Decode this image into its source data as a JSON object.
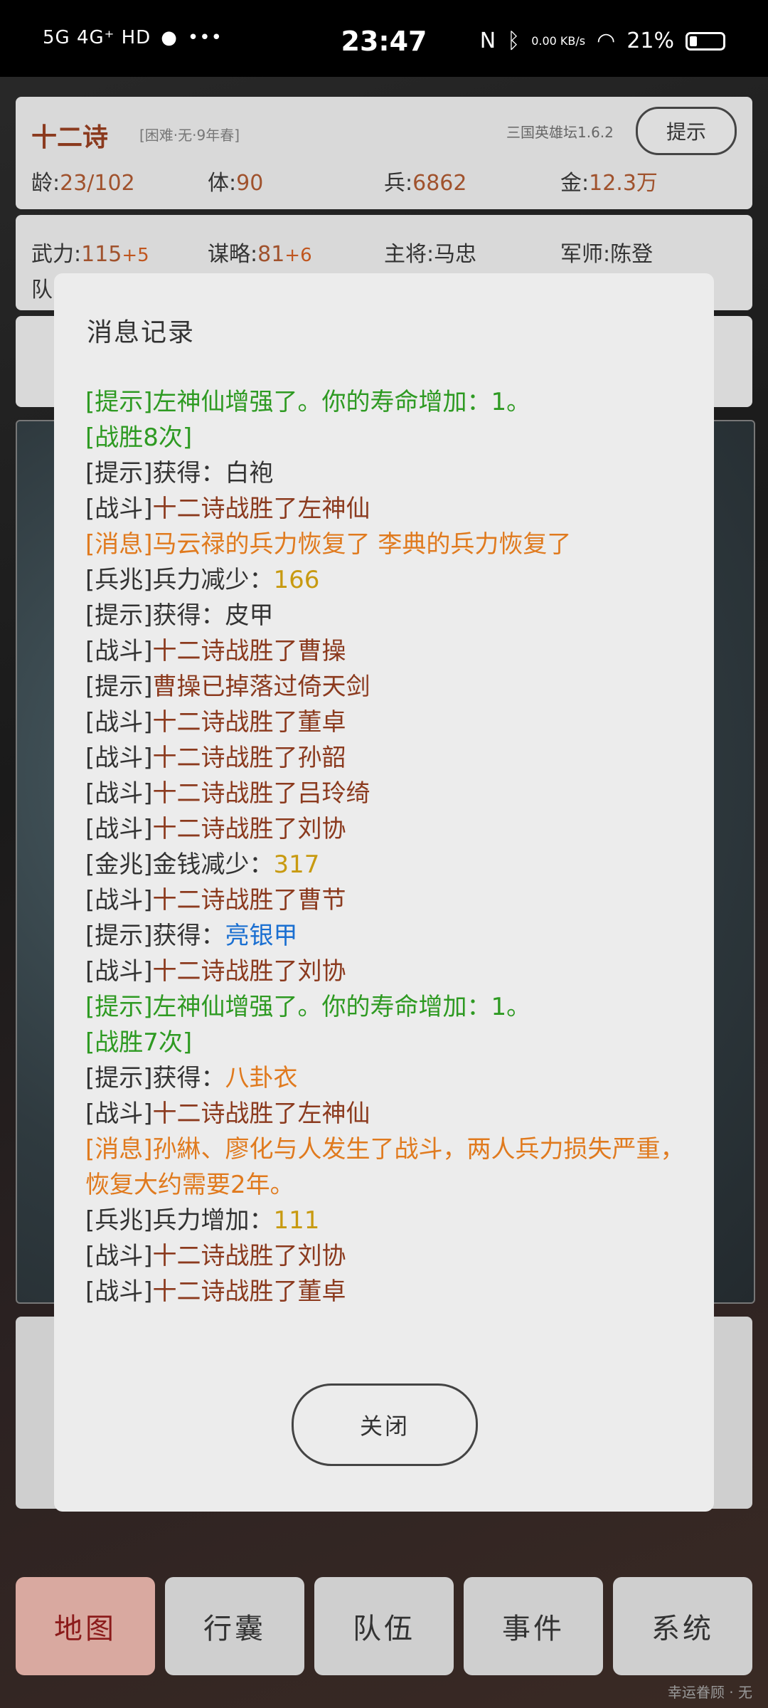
{
  "statusbar": {
    "network": "5G 4G⁺ HD",
    "time": "23:47",
    "speed": "0.00 KB/s",
    "battery": "21%"
  },
  "hero": {
    "name": "十二诗",
    "sub": "[困难·无·9年春]",
    "version": "三国英雄坛1.6.2",
    "hint_label": "提示",
    "age_label": "龄:",
    "age_value": "23/102",
    "body_label": "体:",
    "body_value": "90",
    "troops_label": "兵:",
    "troops_value": "6862",
    "gold_label": "金:",
    "gold_value": "12.3万"
  },
  "attrs": {
    "force_label": "武力:",
    "force_value": "115",
    "force_bonus": "+5",
    "strategy_label": "谋略:",
    "strategy_value": "81",
    "strategy_bonus": "+6",
    "general_label": "主将:",
    "general_value": "马忠",
    "advisor_label": "军师:",
    "advisor_value": "陈登",
    "team_label": "队"
  },
  "nav": {
    "map": "地图",
    "bag": "行囊",
    "team": "队伍",
    "events": "事件",
    "system": "系统",
    "active": "map"
  },
  "footer_note": "幸运眷顾 · 无",
  "modal": {
    "title": "消息记录",
    "close_label": "关闭",
    "log": [
      {
        "tag": "[提示]",
        "text": "左神仙增强了。你的寿命增加：1。",
        "style": "green"
      },
      {
        "tag": "",
        "text": "[战胜8次]",
        "style": "green"
      },
      {
        "tag": "[提示]",
        "text": "获得：白袍",
        "style": "plain"
      },
      {
        "tag": "[战斗]",
        "text": "十二诗战胜了左神仙",
        "style": "brown"
      },
      {
        "tag": "[消息]",
        "text": "马云禄的兵力恢复了 李典的兵力恢复了",
        "style": "orange"
      },
      {
        "tag": "[兵兆]",
        "text": "兵力减少：",
        "value": "166",
        "style": "gold"
      },
      {
        "tag": "[提示]",
        "text": "获得：皮甲",
        "style": "plain"
      },
      {
        "tag": "[战斗]",
        "text": "十二诗战胜了曹操",
        "style": "brown"
      },
      {
        "tag": "[提示]",
        "text": "曹操已掉落过倚天剑",
        "style": "brown"
      },
      {
        "tag": "[战斗]",
        "text": "十二诗战胜了董卓",
        "style": "brown"
      },
      {
        "tag": "[战斗]",
        "text": "十二诗战胜了孙韶",
        "style": "brown"
      },
      {
        "tag": "[战斗]",
        "text": "十二诗战胜了吕玲绮",
        "style": "brown"
      },
      {
        "tag": "[战斗]",
        "text": "十二诗战胜了刘协",
        "style": "brown"
      },
      {
        "tag": "[金兆]",
        "text": "金钱减少：",
        "value": "317",
        "style": "gold"
      },
      {
        "tag": "[战斗]",
        "text": "十二诗战胜了曹节",
        "style": "brown"
      },
      {
        "tag": "[提示]",
        "text": "获得：",
        "value": "亮银甲",
        "style": "blue"
      },
      {
        "tag": "[战斗]",
        "text": "十二诗战胜了刘协",
        "style": "brown"
      },
      {
        "tag": "[提示]",
        "text": "左神仙增强了。你的寿命增加：1。",
        "style": "green"
      },
      {
        "tag": "",
        "text": "[战胜7次]",
        "style": "green"
      },
      {
        "tag": "[提示]",
        "text": "获得：",
        "value": "八卦衣",
        "style": "orangeval"
      },
      {
        "tag": "[战斗]",
        "text": "十二诗战胜了左神仙",
        "style": "brown"
      },
      {
        "tag": "[消息]",
        "text": "孙綝、廖化与人发生了战斗，两人兵力损失严重，恢复大约需要2年。",
        "style": "orange"
      },
      {
        "tag": "[兵兆]",
        "text": "兵力增加：",
        "value": "111",
        "style": "gold"
      },
      {
        "tag": "[战斗]",
        "text": "十二诗战胜了刘协",
        "style": "brown"
      },
      {
        "tag": "[战斗]",
        "text": "十二诗战胜了董卓",
        "style": "brown"
      }
    ]
  }
}
